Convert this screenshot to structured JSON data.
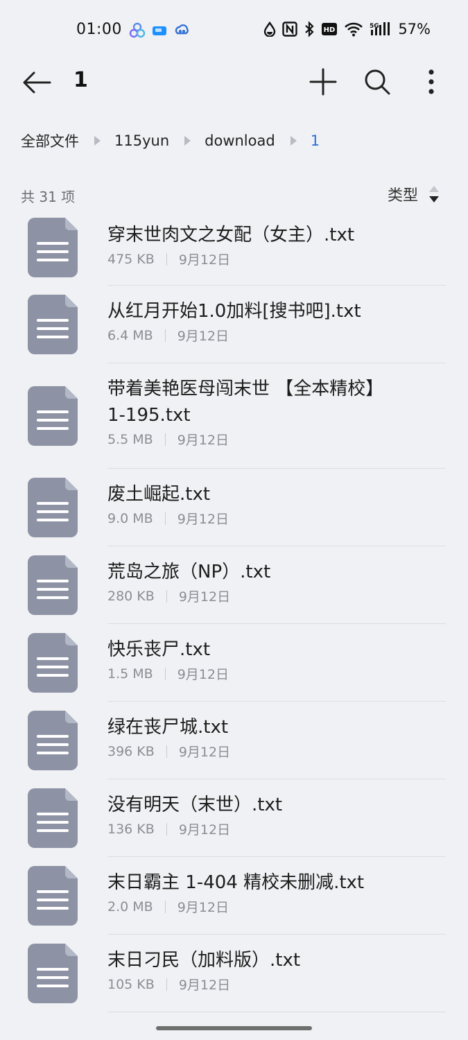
{
  "status_bar": {
    "time": "01:00",
    "battery": "57%",
    "icons": [
      "app-icon-1",
      "app-icon-2",
      "app-icon-3",
      "drop-icon",
      "nfc-icon",
      "bluetooth-icon",
      "hd-icon",
      "wifi-icon",
      "5g-signal-icon"
    ]
  },
  "toolbar": {
    "title": "1",
    "icons": [
      "back-arrow-icon",
      "plus-icon",
      "search-icon",
      "more-vertical-icon"
    ]
  },
  "breadcrumb": [
    "全部文件",
    "115yun",
    "download",
    "1"
  ],
  "list_header": {
    "count": "共 31 项",
    "sort_label": "类型"
  },
  "files": [
    {
      "name": "穿末世肉文之女配（女主）.txt",
      "size": "475 KB",
      "date": "9月12日"
    },
    {
      "name": "从红月开始1.0加料[搜书吧].txt",
      "size": "6.4 MB",
      "date": "9月12日"
    },
    {
      "name": "带着美艳医母闯末世 【全本精校】1-195.txt",
      "size": "5.5 MB",
      "date": "9月12日"
    },
    {
      "name": "废土崛起.txt",
      "size": "9.0 MB",
      "date": "9月12日"
    },
    {
      "name": "荒岛之旅（NP）.txt",
      "size": "280 KB",
      "date": "9月12日"
    },
    {
      "name": "快乐丧尸.txt",
      "size": "1.5 MB",
      "date": "9月12日"
    },
    {
      "name": "绿在丧尸城.txt",
      "size": "396 KB",
      "date": "9月12日"
    },
    {
      "name": "没有明天（末世）.txt",
      "size": "136 KB",
      "date": "9月12日"
    },
    {
      "name": "末日霸主 1-404 精校未删减.txt",
      "size": "2.0 MB",
      "date": "9月12日"
    },
    {
      "name": "末日刁民（加料版）.txt",
      "size": "105 KB",
      "date": "9月12日"
    }
  ],
  "colors": {
    "background": "#f0f1f4",
    "icon": "#8d93a5",
    "accent": "#2b6fd6",
    "text": "#1c1c1c",
    "meta": "#8a8d93"
  }
}
